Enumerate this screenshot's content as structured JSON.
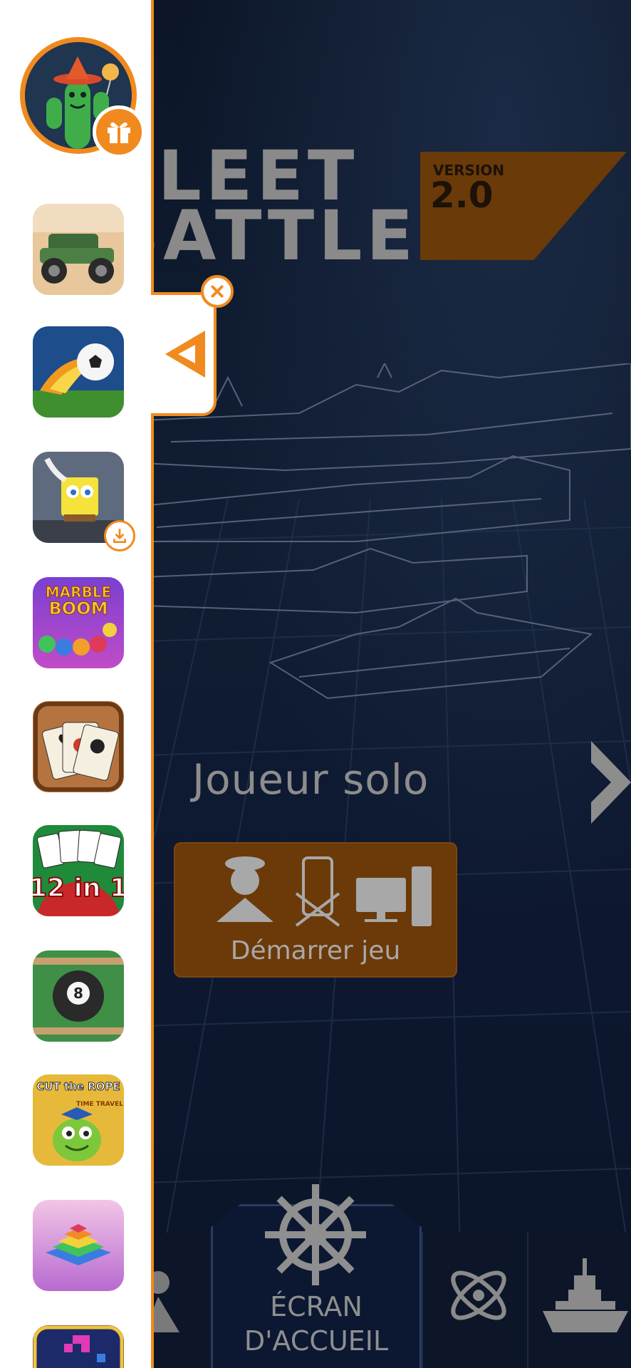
{
  "game": {
    "logo": {
      "line1": "FLEET",
      "line2": "BATTLE",
      "badge_small": "VERSION",
      "badge_big": "2.0"
    },
    "mode_label": "Joueur solo",
    "start_button_label": "Démarrer jeu",
    "bottom_nav": {
      "home_label_line1": "ÉCRAN",
      "home_label_line2": "D'ACCUEIL"
    }
  },
  "sidebar": {
    "profile_icon": "cactus-avatar",
    "gift_icon": "gift-icon",
    "games": [
      {
        "name": "monster-truck-game",
        "icon": "jeep"
      },
      {
        "name": "soccer-game",
        "icon": "fireball-soccer"
      },
      {
        "name": "spongebob-game",
        "icon": "spongebob"
      },
      {
        "name": "marble-boom-game",
        "icon": "marble-boom"
      },
      {
        "name": "solitaire-game",
        "icon": "playing-cards"
      },
      {
        "name": "card-games-12in1",
        "icon": "12-in-1-cards"
      },
      {
        "name": "billiards-game",
        "icon": "8-ball"
      },
      {
        "name": "cut-the-rope-game",
        "icon": "om-nom"
      },
      {
        "name": "stack-game",
        "icon": "stacked-blocks"
      },
      {
        "name": "tetris-game",
        "icon": "blocks"
      }
    ],
    "tile_texts": {
      "marble_line1": "MARBLE",
      "marble_line2": "BOOM",
      "twelve_in_one": "12 in 1",
      "cut_rope": "CUT the ROPE",
      "time_travel": "TIME TRAVEL"
    }
  },
  "colors": {
    "accent_orange": "#f08a1e",
    "game_orange": "#6b3a08",
    "background_navy": "#0c1628"
  }
}
